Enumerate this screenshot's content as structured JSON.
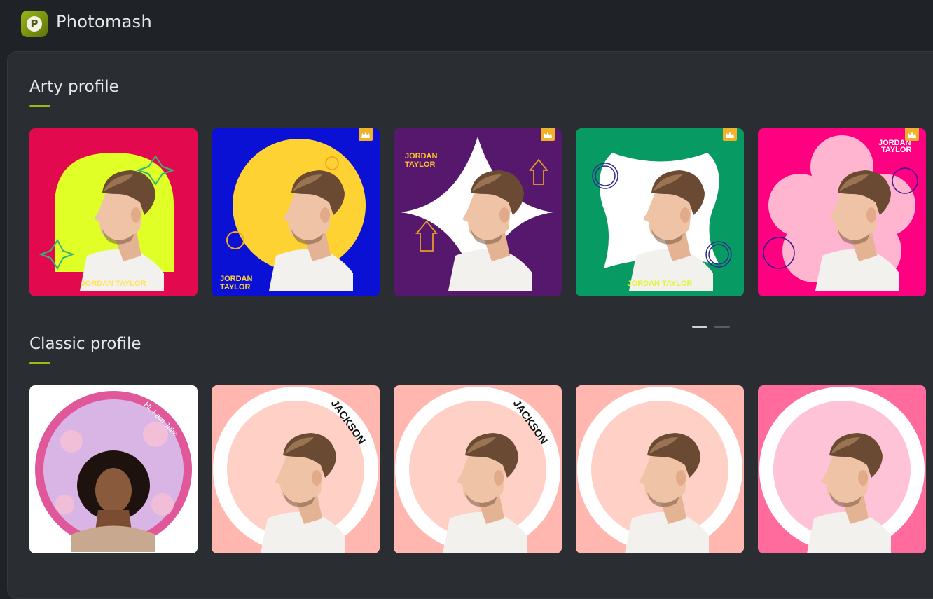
{
  "app": {
    "title": "Photomash",
    "logo_letter": "P"
  },
  "sections": [
    {
      "title": "Arty profile",
      "cards": [
        {
          "name": "JORDAN TAYLOR",
          "bg": "#e2094e",
          "premium": false
        },
        {
          "name_line1": "JORDAN",
          "name_line2": "TAYLOR",
          "bg": "#0a10d4",
          "premium": true
        },
        {
          "name_line1": "JORDAN",
          "name_line2": "TAYLOR",
          "bg": "#55186c",
          "premium": true
        },
        {
          "name": "JORDAN TAYLOR",
          "bg": "#089a63",
          "premium": true
        },
        {
          "name_line1": "JORDAN",
          "name_line2": "TAYLOR",
          "bg": "#ff0080",
          "premium": true
        }
      ]
    },
    {
      "title": "Classic profile",
      "cards": [
        {
          "caption": "Hi, I am Julie",
          "bg": "#ffffff"
        },
        {
          "name": "JACKSON",
          "bg": "#ffb7b0"
        },
        {
          "name": "JACKSON",
          "bg": "#ffb7b0"
        },
        {
          "bg": "#ffb7b0"
        },
        {
          "bg": "#ff6b9c"
        }
      ]
    }
  ],
  "pagination": {
    "pages": 2,
    "active": 1
  },
  "colors": {
    "accent": "#9cb71a",
    "premium_badge": "#f0b22a",
    "background": "#1f2226",
    "panel": "#2a2d32"
  },
  "icons": {
    "premium": "crown-icon",
    "logo": "photomash-logo-icon"
  }
}
